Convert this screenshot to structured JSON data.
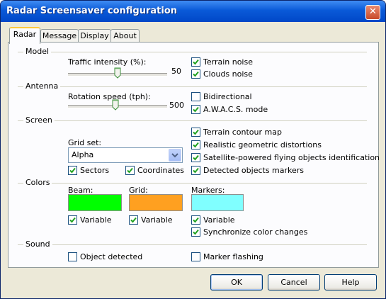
{
  "window": {
    "title": "Radar Screensaver configuration",
    "close_glyph": "✕"
  },
  "tabs": [
    {
      "label": "Radar",
      "active": true
    },
    {
      "label": "Message",
      "active": false
    },
    {
      "label": "Display",
      "active": false
    },
    {
      "label": "About",
      "active": false
    }
  ],
  "model": {
    "section_label": "Model",
    "traffic": {
      "label": "Traffic intensity (%):",
      "value": "50",
      "level": 50
    },
    "terrain_noise": {
      "label": "Terrain noise",
      "checked": true
    },
    "clouds_noise": {
      "label": "Clouds noise",
      "checked": true
    }
  },
  "antenna": {
    "section_label": "Antenna",
    "rotation": {
      "label": "Rotation speed (tph):",
      "value": "500",
      "level": 48
    },
    "bidirectional": {
      "label": "Bidirectional",
      "checked": false
    },
    "awacs": {
      "label": "A.W.A.C.S. mode",
      "checked": true
    }
  },
  "screen": {
    "section_label": "Screen",
    "grid_set": {
      "label": "Grid set:",
      "value": "Alpha"
    },
    "sectors": {
      "label": "Sectors",
      "checked": true
    },
    "coordinates": {
      "label": "Coordinates",
      "checked": true
    },
    "terrain_contour": {
      "label": "Terrain contour map",
      "checked": true
    },
    "geometric": {
      "label": "Realistic geometric distortions",
      "checked": true
    },
    "satellite": {
      "label": "Satellite-powered flying objects identification",
      "checked": true
    },
    "detected_markers": {
      "label": "Detected objects markers",
      "checked": true
    }
  },
  "colors": {
    "section_label": "Colors",
    "beam": {
      "label": "Beam:",
      "color": "#00ff00",
      "variable_label": "Variable",
      "variable_checked": true
    },
    "grid": {
      "label": "Grid:",
      "color": "#ffa020",
      "variable_label": "Variable",
      "variable_checked": true
    },
    "markers": {
      "label": "Markers:",
      "color": "#80ffff",
      "variable_label": "Variable",
      "variable_checked": true
    },
    "sync": {
      "label": "Synchronize color changes",
      "checked": true
    }
  },
  "sound": {
    "section_label": "Sound",
    "object_detected": {
      "label": "Object detected",
      "checked": false
    },
    "marker_flashing": {
      "label": "Marker flashing",
      "checked": false
    }
  },
  "buttons": {
    "ok": "OK",
    "cancel": "Cancel",
    "help": "Help"
  }
}
